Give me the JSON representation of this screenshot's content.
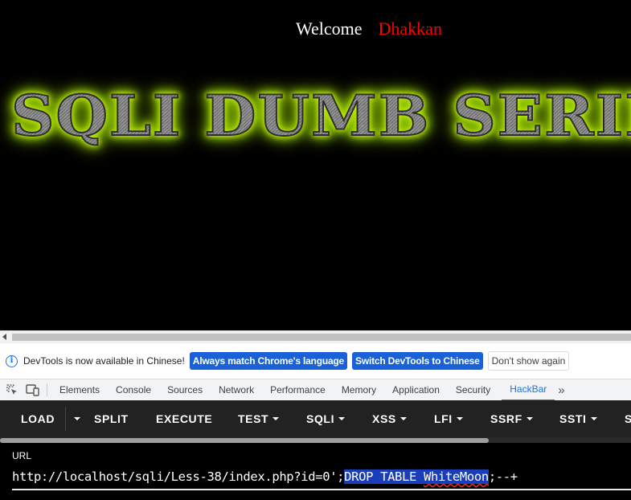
{
  "webpage": {
    "welcome_label": "Welcome",
    "username": "Dhakkan",
    "banner_text": "SQLI DUMB SERIES"
  },
  "infobar": {
    "message": "DevTools is now available in Chinese!",
    "btn_match": "Always match Chrome's language",
    "btn_switch": "Switch DevTools to Chinese",
    "btn_dismiss": "Don't show again"
  },
  "devtools": {
    "tabs": [
      "Elements",
      "Console",
      "Sources",
      "Network",
      "Performance",
      "Memory",
      "Application",
      "Security",
      "HackBar"
    ],
    "active_tab": "HackBar",
    "more_icon": "»"
  },
  "hackbar": {
    "buttons": [
      "LOAD",
      "SPLIT",
      "EXECUTE",
      "TEST",
      "SQLI",
      "XSS",
      "LFI",
      "SSRF",
      "SSTI",
      "S"
    ],
    "url_label": "URL",
    "url_prefix": "http://localhost/sqli/Less-38/index.php?id=0';",
    "url_selected_part1": "DROP TABLE ",
    "url_selected_word": "WhiteMoon",
    "url_suffix": ";--+"
  },
  "colors": {
    "welcome": "#ffffff",
    "username": "#ff0000",
    "banner_glow": "#a6e000",
    "active_tab": "#1a73e8",
    "hackbar_bg": "#222222",
    "selection": "#1a3db8"
  }
}
